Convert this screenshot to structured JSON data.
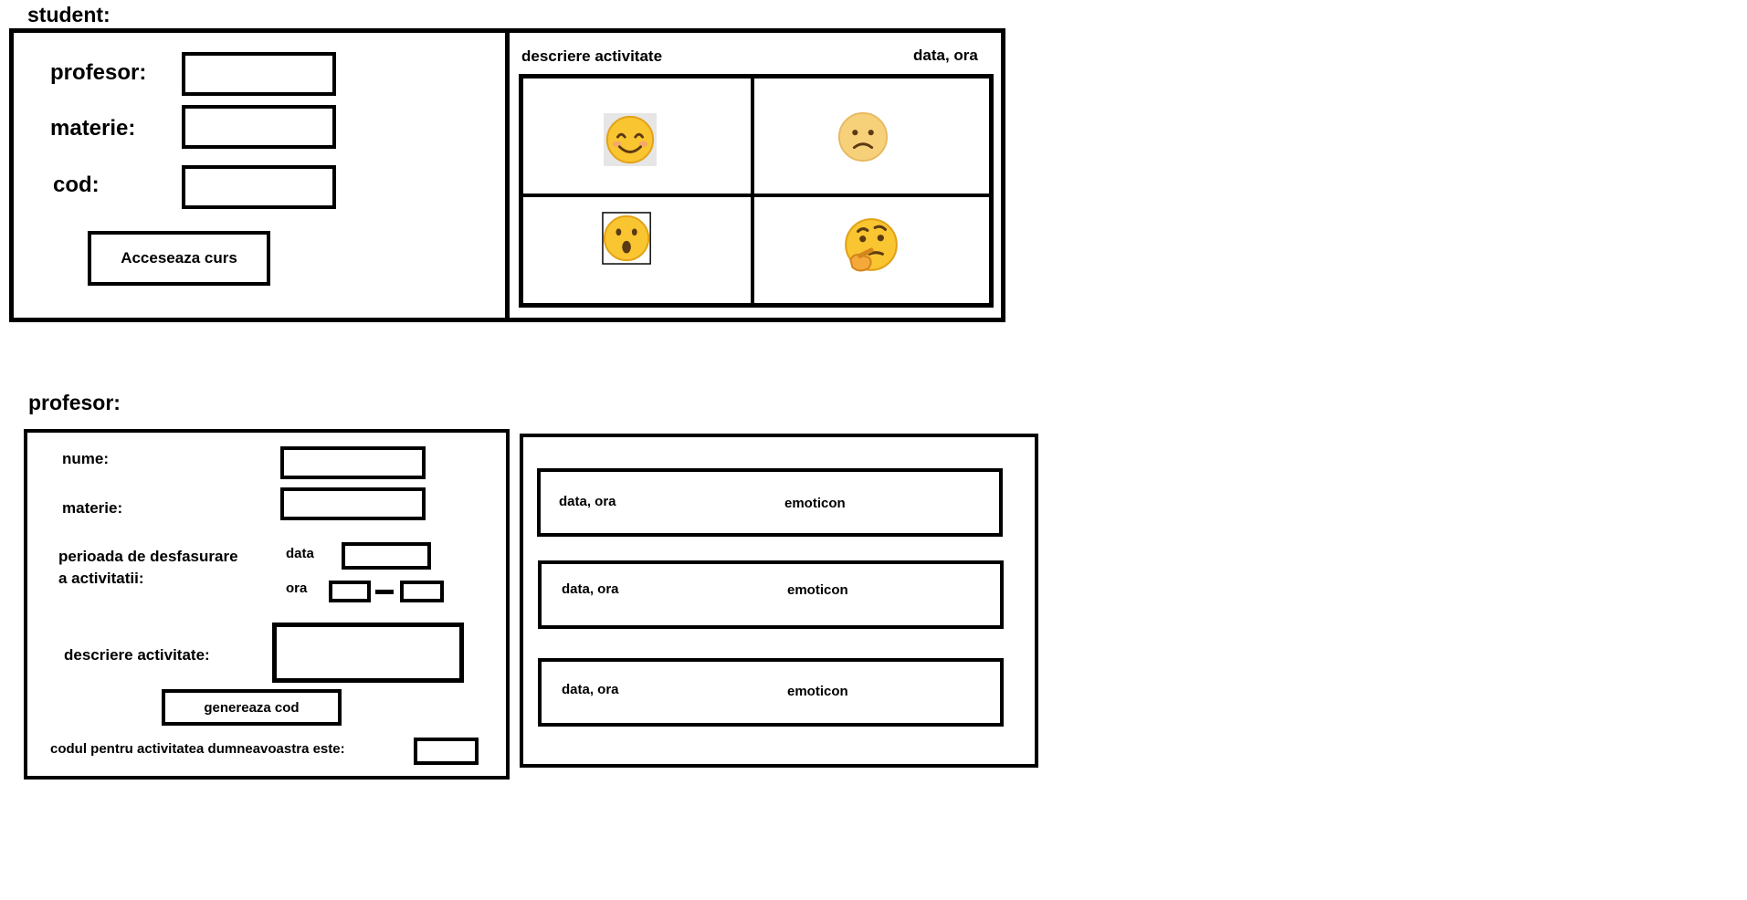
{
  "student": {
    "heading": "student:",
    "fields": {
      "profesor_label": "profesor:",
      "materie_label": "materie:",
      "cod_label": "cod:"
    },
    "access_button": "Acceseaza curs",
    "activity": {
      "description_label": "descriere activitate",
      "datetime_label": "data, ora",
      "emoticons": [
        "smiling-face",
        "slightly-frowning-face",
        "hushed-face",
        "thinking-face"
      ]
    }
  },
  "profesor": {
    "heading": "profesor:",
    "fields": {
      "nume_label": "nume:",
      "materie_label": "materie:",
      "period_label_line1": "perioada de desfasurare",
      "period_label_line2": "a activitatii:",
      "data_label": "data",
      "ora_label": "ora",
      "description_label": "descriere activitate:"
    },
    "generate_button": "genereaza cod",
    "code_label": "codul pentru activitatea dumneavoastra este:",
    "feedback": [
      {
        "datetime": "data, ora",
        "emoticon": "emoticon"
      },
      {
        "datetime": "data, ora",
        "emoticon": "emoticon"
      },
      {
        "datetime": "data, ora",
        "emoticon": "emoticon"
      }
    ]
  }
}
